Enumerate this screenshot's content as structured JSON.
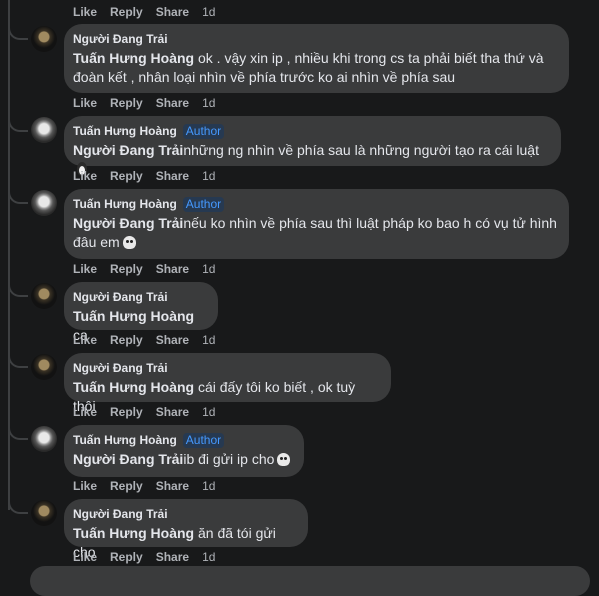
{
  "actions": {
    "like": "Like",
    "reply": "Reply",
    "share": "Share"
  },
  "top_actions": {
    "time": "1d"
  },
  "comments": [
    {
      "author": "Người Đang Trải",
      "badge": "",
      "tag": "Tuấn Hưng Hoàng",
      "text": " ok . vậy xin ip , nhiều khi trong cs ta phải biết tha thứ và đoàn kết , nhân loại nhìn về phía trước ko ai nhìn về phía sau",
      "emoji": "",
      "time": "1d"
    },
    {
      "author": "Tuấn Hưng Hoàng",
      "badge": "Author",
      "tag": "Người Đang Trải",
      "text": "những ng nhìn về phía sau là những người tạo ra cái luật",
      "emoji": "penguin-icon",
      "time": "1d"
    },
    {
      "author": "Tuấn Hưng Hoàng",
      "badge": "Author",
      "tag": "Người Đang Trải",
      "text": "nếu ko nhìn về phía sau thì luật pháp ko bao h có vụ tử hình đâu em",
      "emoji": "skull-icon",
      "time": "1d"
    },
    {
      "author": "Người Đang Trải",
      "badge": "",
      "tag": "Tuấn Hưng Hoàng",
      "text": " ca",
      "emoji": "",
      "time": "1d"
    },
    {
      "author": "Người Đang Trải",
      "badge": "",
      "tag": "Tuấn Hưng Hoàng",
      "text": " cái đấy tôi ko biết , ok tuỳ thôi",
      "emoji": "",
      "time": "1d"
    },
    {
      "author": "Tuấn Hưng Hoàng",
      "badge": "Author",
      "tag": "Người Đang Trải",
      "text": "ib đi gửi ip cho",
      "emoji": "skull-icon",
      "time": "1d"
    },
    {
      "author": "Người Đang Trải",
      "badge": "",
      "tag": "Tuấn Hưng Hoàng",
      "text": " ăn đã tói gửi cho",
      "emoji": "",
      "time": "1d"
    }
  ]
}
